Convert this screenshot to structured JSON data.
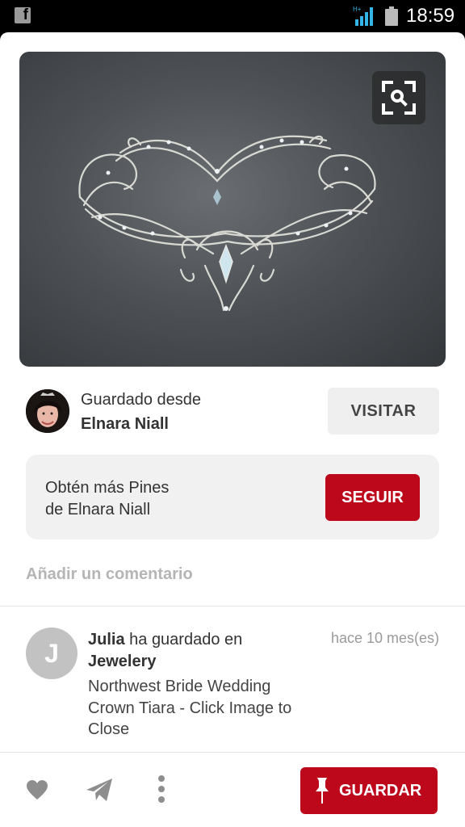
{
  "status_bar": {
    "time": "18:59",
    "network": "H+",
    "app_icon": "f"
  },
  "pin": {
    "image_alt": "silver wire crown tiara with crystals",
    "lens_icon": "visual-search-icon"
  },
  "source": {
    "saved_from_label": "Guardado desde",
    "name": "Elnara Niall",
    "visit_label": "VISITAR"
  },
  "follow": {
    "line1": "Obtén más Pines",
    "line2": "de Elnara Niall",
    "button_label": "SEGUIR"
  },
  "comment": {
    "placeholder": "Añadir un comentario"
  },
  "activity": {
    "avatar_letter": "J",
    "user": "Julia",
    "action": " ha guardado en",
    "board": "Jewelery",
    "description": "Northwest Bride Wedding Crown Tiara - Click Image to Close",
    "time": "hace 10 mes(es)"
  },
  "actions": {
    "like_icon": "heart-icon",
    "send_icon": "send-icon",
    "more_icon": "more-vertical-icon",
    "save_label": "GUARDAR"
  },
  "colors": {
    "accent": "#bd081c",
    "muted": "#efefef"
  }
}
